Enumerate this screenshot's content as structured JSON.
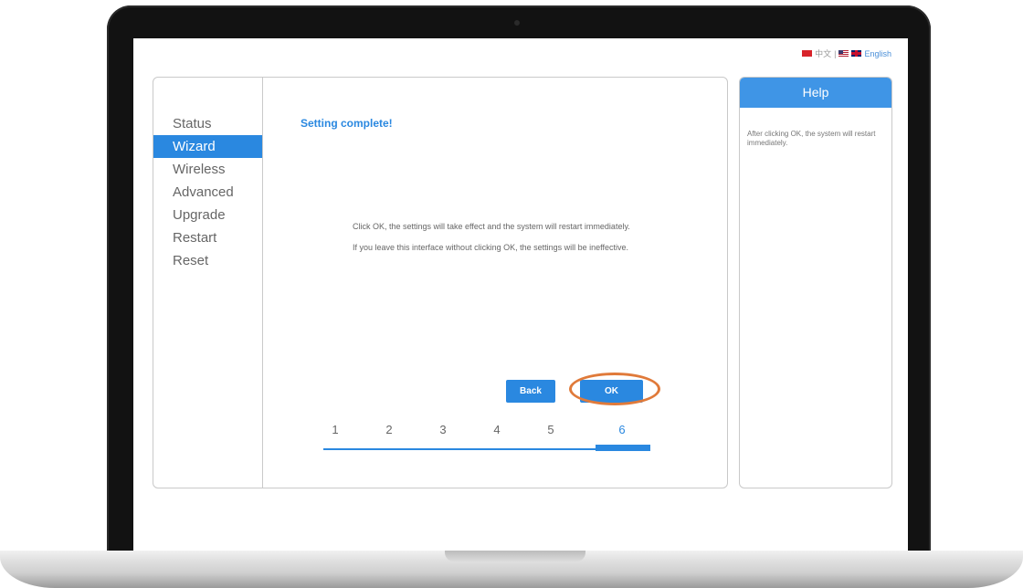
{
  "language": {
    "chinese_label": "中文",
    "separator": "|",
    "english_label": "English"
  },
  "sidebar": {
    "items": [
      {
        "label": "Status",
        "active": false
      },
      {
        "label": "Wizard",
        "active": true
      },
      {
        "label": "Wireless",
        "active": false
      },
      {
        "label": "Advanced",
        "active": false
      },
      {
        "label": "Upgrade",
        "active": false
      },
      {
        "label": "Restart",
        "active": false
      },
      {
        "label": "Reset",
        "active": false
      }
    ]
  },
  "main": {
    "title": "Setting complete!",
    "message_1": "Click OK, the settings will take effect and the system will restart immediately.",
    "message_2": "If you leave this interface without clicking OK, the settings will be ineffective.",
    "back_label": "Back",
    "ok_label": "OK",
    "steps": [
      "1",
      "2",
      "3",
      "4",
      "5",
      "6"
    ],
    "current_step": 6
  },
  "help": {
    "title": "Help",
    "text": "After clicking OK, the system will restart immediately."
  },
  "colors": {
    "accent": "#2a88e0",
    "highlight": "#e07a3a"
  }
}
